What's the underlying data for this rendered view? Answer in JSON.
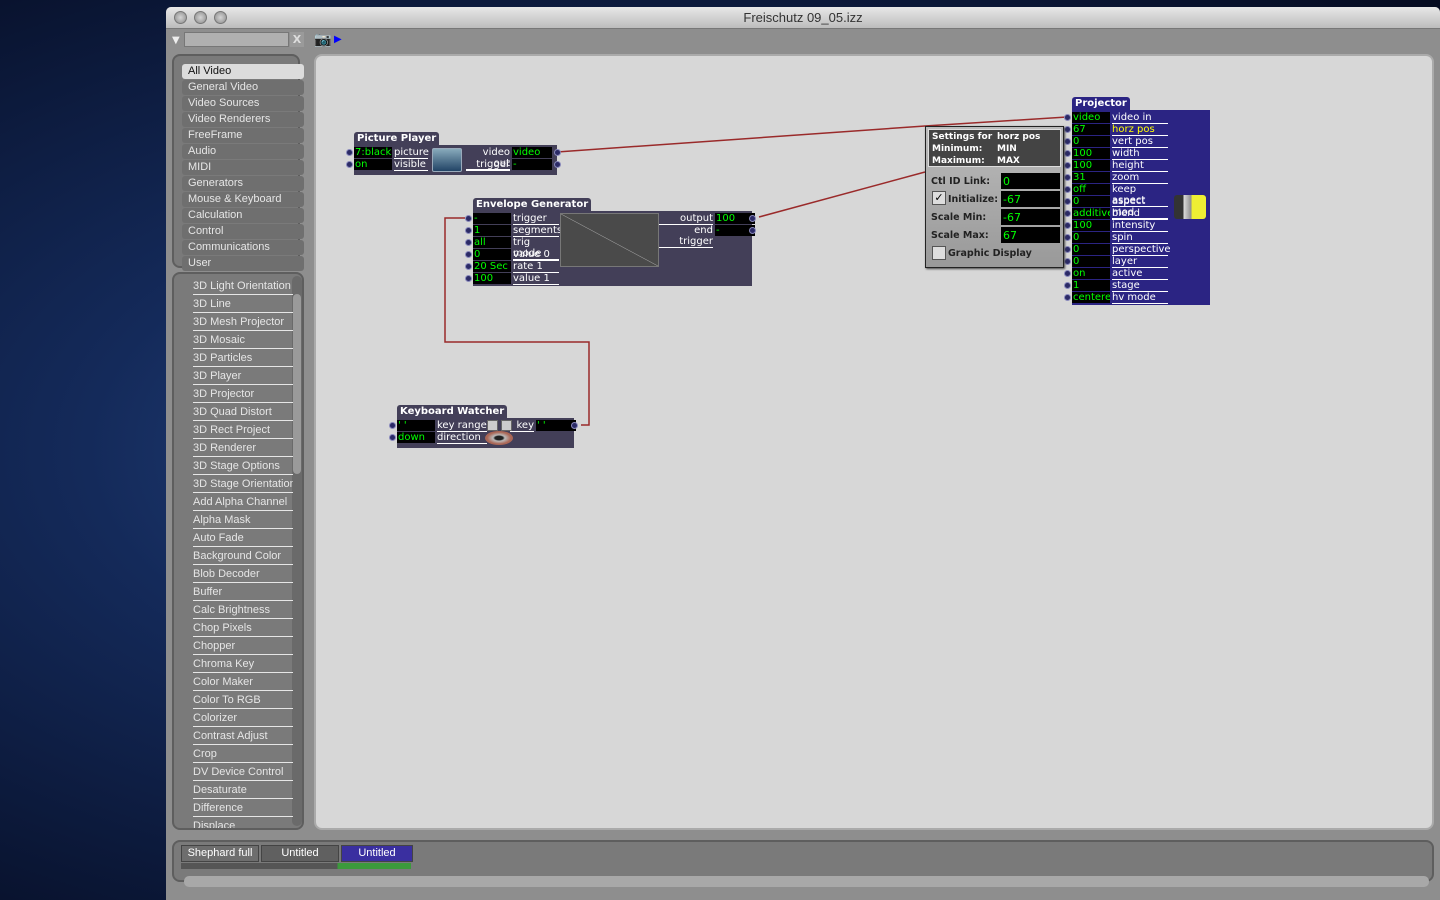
{
  "window": {
    "title": "Freischutz 09_05.izz"
  },
  "toolbar": {
    "search_value": "",
    "clear_label": "X",
    "camera_icon": "camera-icon",
    "play_icon": "play-arrow-icon"
  },
  "categories": [
    "All Video",
    "General Video",
    "Video Sources",
    "Video Renderers",
    "FreeFrame",
    "Audio",
    "MIDI",
    "Generators",
    "Mouse & Keyboard",
    "Calculation",
    "Control",
    "Communications",
    "User"
  ],
  "selected_category": "All Video",
  "actors": [
    "3D Light Orientation",
    "3D Line",
    "3D Mesh Projector",
    "3D Mosaic",
    "3D Particles",
    "3D Player",
    "3D Projector",
    "3D Quad Distort",
    "3D Rect Project",
    "3D Renderer",
    "3D Stage Options",
    "3D Stage Orientation",
    "Add Alpha Channel",
    "Alpha Mask",
    "Auto Fade",
    "Background Color",
    "Blob Decoder",
    "Buffer",
    "Calc Brightness",
    "Chop Pixels",
    "Chopper",
    "Chroma Key",
    "Color Maker",
    "Color To RGB",
    "Colorizer",
    "Contrast Adjust",
    "Crop",
    "DV Device Control",
    "Desaturate",
    "Difference",
    "Displace"
  ],
  "picture_player": {
    "title": "Picture Player",
    "inputs": [
      {
        "value": "7:black",
        "label": "picture"
      },
      {
        "value": "on",
        "label": "visible"
      }
    ],
    "outputs": [
      {
        "label": "video out",
        "value": "video"
      },
      {
        "label": "trigger",
        "value": "-"
      }
    ]
  },
  "envelope": {
    "title": "Envelope Generator",
    "inputs": [
      {
        "value": "-",
        "label": "trigger"
      },
      {
        "value": "1",
        "label": "segments"
      },
      {
        "value": "all",
        "label": "trig mode"
      },
      {
        "value": "0",
        "label": "value 0"
      },
      {
        "value": "20 Sec",
        "label": "rate 1"
      },
      {
        "value": "100",
        "label": "value 1"
      }
    ],
    "outputs": [
      {
        "label": "output",
        "value": "100"
      },
      {
        "label": "end trigger",
        "value": "-"
      }
    ]
  },
  "keyboard": {
    "title": "Keyboard Watcher",
    "inputs": [
      {
        "value": "' '",
        "label": "key range"
      },
      {
        "value": "down",
        "label": "direction"
      }
    ],
    "outputs": [
      {
        "label": "key",
        "value": "' '"
      }
    ]
  },
  "projector": {
    "title": "Projector",
    "inputs": [
      {
        "value": "video",
        "label": "video in"
      },
      {
        "value": "67",
        "label": "horz pos"
      },
      {
        "value": "0",
        "label": "vert pos"
      },
      {
        "value": "100",
        "label": "width"
      },
      {
        "value": "100",
        "label": "height"
      },
      {
        "value": "31",
        "label": "zoom"
      },
      {
        "value": "off",
        "label": "keep aspect"
      },
      {
        "value": "0",
        "label": "aspect mod"
      },
      {
        "value": "additive",
        "label": "blend"
      },
      {
        "value": "100",
        "label": "intensity"
      },
      {
        "value": "0",
        "label": "spin"
      },
      {
        "value": "0",
        "label": "perspective"
      },
      {
        "value": "0",
        "label": "layer"
      },
      {
        "value": "on",
        "label": "active"
      },
      {
        "value": "1",
        "label": "stage"
      },
      {
        "value": "centered",
        "label": "hv mode"
      }
    ],
    "highlight_color": "#ffff00"
  },
  "settings": {
    "settings_for_label": "Settings for",
    "settings_for": "horz pos",
    "minimum_label": "Minimum:",
    "minimum": "MIN",
    "maximum_label": "Maximum:",
    "maximum": "MAX",
    "ctl_id_label": "Ctl ID Link:",
    "ctl_id": "0",
    "initialize_label": "Initialize:",
    "initialize": "-67",
    "initialize_checked": true,
    "scale_min_label": "Scale Min:",
    "scale_min": "-67",
    "scale_max_label": "Scale Max:",
    "scale_max": "67",
    "graphic_display_label": "Graphic Display",
    "graphic_display_checked": false
  },
  "scene_tabs": [
    {
      "label": "Shephard full",
      "active": false
    },
    {
      "label": "Untitled",
      "active": false
    },
    {
      "label": "Untitled",
      "active": true
    }
  ],
  "colors": {
    "module_bg": "#433f58",
    "projector_bg": "#2b2483",
    "value_text": "#00ff00",
    "wire": "#9a2a2a",
    "active_tab": "#3a2fa0"
  }
}
